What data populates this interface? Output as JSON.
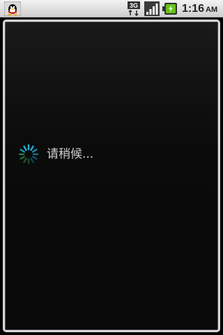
{
  "status_bar": {
    "notification_icon": "qq-penguin-icon",
    "network_label": "3G",
    "signal_icon": "signal-strength-icon",
    "battery_icon": "battery-charging-icon",
    "clock_time": "1:16",
    "clock_ampm": "AM"
  },
  "dialog": {
    "spinner_icon": "loading-spinner-icon",
    "message": "请稍候..."
  },
  "colors": {
    "spinner_accent": "#1fb0d8",
    "dialog_border": "#d6d6d6",
    "message_text": "#cfcfcf"
  }
}
